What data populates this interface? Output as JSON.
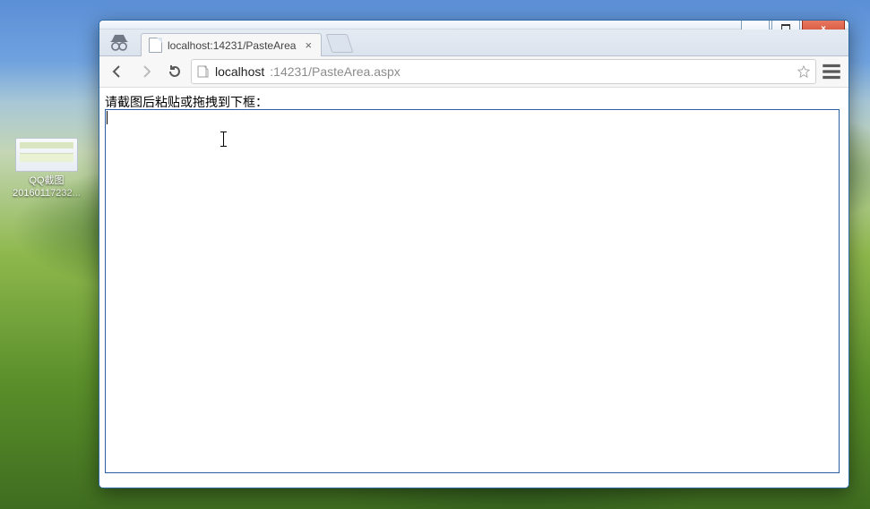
{
  "desktop_icon": {
    "line1": "QQ截图",
    "line2": "20160117232..."
  },
  "tab": {
    "title": "localhost:14231/PasteArea"
  },
  "address": {
    "host": "localhost",
    "port_path": ":14231/PasteArea.aspx"
  },
  "page": {
    "prompt": "请截图后粘贴或拖拽到下框："
  },
  "glyph": {
    "close_x": "×",
    "tab_x": "×"
  }
}
